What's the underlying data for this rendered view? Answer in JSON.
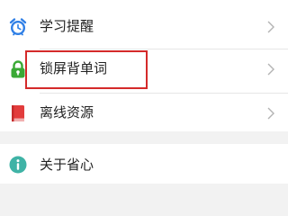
{
  "settings": {
    "items": [
      {
        "label": "学习提醒",
        "icon": "alarm-clock-icon"
      },
      {
        "label": "锁屏背单词",
        "icon": "lock-icon"
      },
      {
        "label": "离线资源",
        "icon": "book-icon"
      }
    ],
    "about": {
      "label": "关于省心",
      "icon": "info-icon"
    }
  },
  "colors": {
    "background": "#f2f2f2",
    "highlight_border": "#d42a2a",
    "alarm_blue": "#2f7fe6",
    "lock_green": "#3aa935",
    "book_red": "#e23c3c",
    "info_teal": "#3fb3a6"
  }
}
